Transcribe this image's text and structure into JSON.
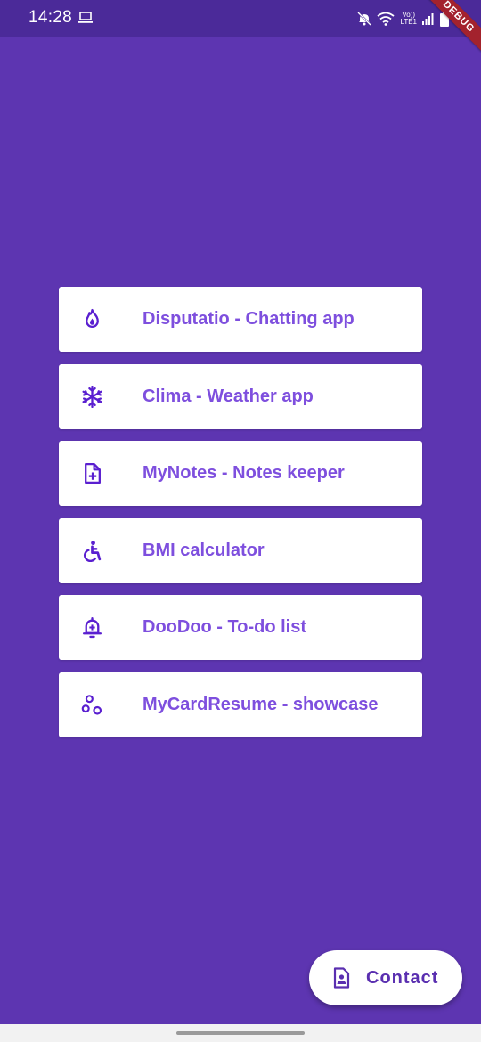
{
  "status_bar": {
    "time": "14:28",
    "volte_line1": "Vo))",
    "volte_line2": "LTE1",
    "icons": [
      "laptop-icon",
      "mute-icon",
      "wifi-icon",
      "signal-icon",
      "battery-icon"
    ]
  },
  "debug_banner": "DEBUG",
  "menu": {
    "items": [
      {
        "label": "Disputatio - Chatting app",
        "icon": "fire-icon"
      },
      {
        "label": "Clima - Weather app",
        "icon": "snowflake-icon"
      },
      {
        "label": "MyNotes - Notes keeper",
        "icon": "note-add-icon"
      },
      {
        "label": "BMI calculator",
        "icon": "accessibility-icon"
      },
      {
        "label": "DooDoo - To-do list",
        "icon": "notification-add-icon"
      },
      {
        "label": "MyCardResume - showcase",
        "icon": "bubbles-icon"
      }
    ]
  },
  "fab": {
    "label": "Contact",
    "icon": "contact-page-icon"
  },
  "colors": {
    "background": "#5d35b1",
    "status_bar": "#4b2a99",
    "item_text": "#7e4fde",
    "icon": "#5a1fd0",
    "debug_ribbon": "#a3222d"
  }
}
